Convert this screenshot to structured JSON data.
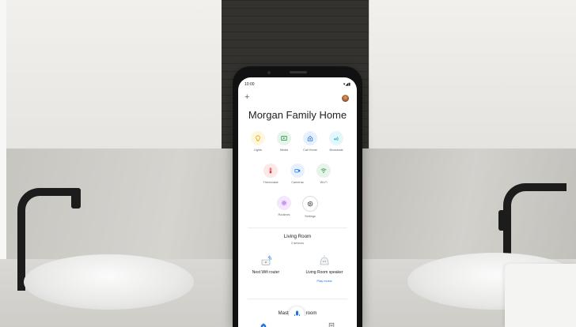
{
  "status_bar": {
    "time": "10:00",
    "indicators": "▾◢▮"
  },
  "header": {
    "add_icon": "+",
    "avatar": "profile-avatar"
  },
  "home": {
    "title": "Morgan Family Home"
  },
  "shortcuts": [
    {
      "label": "Lights",
      "icon": "lightbulb",
      "bg": "#fef7e0",
      "fg": "#f9ab00"
    },
    {
      "label": "Media",
      "icon": "media",
      "bg": "#e6f4ea",
      "fg": "#1e8e3e"
    },
    {
      "label": "Call Home",
      "icon": "call-home",
      "bg": "#e8f0fe",
      "fg": "#1a73e8"
    },
    {
      "label": "Broadcast",
      "icon": "broadcast",
      "bg": "#e4f7fb",
      "fg": "#12b5cb"
    },
    {
      "label": "Thermostat",
      "icon": "thermostat",
      "bg": "#fce8e6",
      "fg": "#d93025"
    },
    {
      "label": "Cameras",
      "icon": "camera",
      "bg": "#e8f0fe",
      "fg": "#1a73e8"
    },
    {
      "label": "Wi-Fi",
      "icon": "wifi",
      "bg": "#e6f4ea",
      "fg": "#1e8e3e"
    },
    {
      "label": "Routines",
      "icon": "routines",
      "bg": "#f3e8fd",
      "fg": "#9334e6"
    },
    {
      "label": "Settings",
      "icon": "gear",
      "bg": "#ffffff",
      "fg": "#3c4043"
    }
  ],
  "room": {
    "title": "Living Room",
    "subtitle": "2 devices",
    "devices": [
      {
        "label": "Nest Wifi router",
        "action": ""
      },
      {
        "label": "Living Room speaker",
        "action": "Play music"
      }
    ]
  },
  "next_room": {
    "title_left": "Mast",
    "title_right": "room"
  },
  "bottom_nav": {
    "home": "home-tab",
    "feed": "feed-tab"
  }
}
